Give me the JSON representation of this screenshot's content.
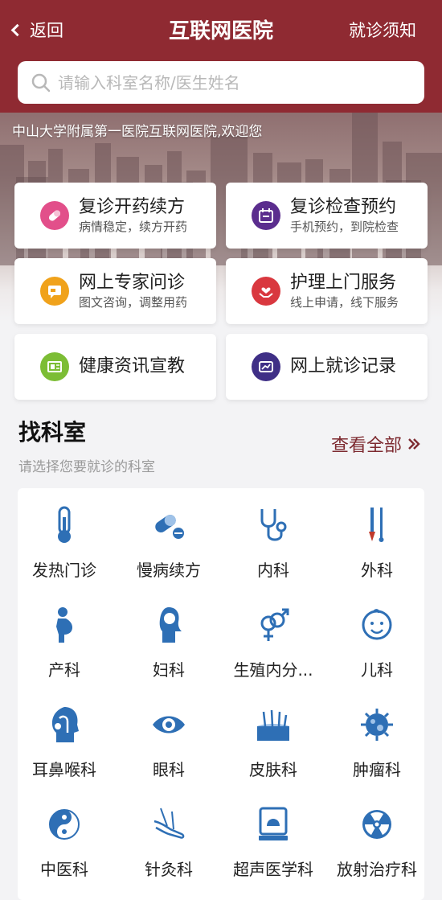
{
  "nav": {
    "back_label": "返回",
    "title": "互联网医院",
    "notice_label": "就诊须知"
  },
  "search": {
    "placeholder": "请输入科室名称/医生姓名",
    "value": ""
  },
  "banner": {
    "welcome": "中山大学附属第一医院互联网医院,欢迎您"
  },
  "services": [
    {
      "name": "复诊开药续方",
      "sub": "病情稳定，续方开药",
      "icon": "pill-icon",
      "color": "#e24f8a"
    },
    {
      "name": "复诊检查预约",
      "sub": "手机预约，到院检查",
      "icon": "calendar-icon",
      "color": "#5b2d8e"
    },
    {
      "name": "网上专家问诊",
      "sub": "图文咨询，调整用药",
      "icon": "chat-icon",
      "color": "#f0a21b"
    },
    {
      "name": "护理上门服务",
      "sub": "线上申请，线下服务",
      "icon": "care-hands-icon",
      "color": "#d9383f"
    },
    {
      "name": "健康资讯宣教",
      "sub": "",
      "icon": "news-icon",
      "color": "#7cbd35"
    },
    {
      "name": "网上就诊记录",
      "sub": "",
      "icon": "record-icon",
      "color": "#3f2f86"
    }
  ],
  "departments_section": {
    "title": "找科室",
    "subtitle": "请选择您要就诊的科室",
    "view_all": "查看全部"
  },
  "departments": [
    {
      "name": "发热门诊",
      "icon": "thermometer-icon"
    },
    {
      "name": "慢病续方",
      "icon": "capsule-icon"
    },
    {
      "name": "内科",
      "icon": "stethoscope-icon"
    },
    {
      "name": "外科",
      "icon": "surgical-tools-icon"
    },
    {
      "name": "产科",
      "icon": "pregnant-icon"
    },
    {
      "name": "妇科",
      "icon": "woman-icon"
    },
    {
      "name": "生殖内分...",
      "icon": "gender-icon"
    },
    {
      "name": "儿科",
      "icon": "baby-face-icon"
    },
    {
      "name": "耳鼻喉科",
      "icon": "ent-head-icon"
    },
    {
      "name": "眼科",
      "icon": "eye-icon"
    },
    {
      "name": "皮肤科",
      "icon": "skin-icon"
    },
    {
      "name": "肿瘤科",
      "icon": "tumor-cell-icon"
    },
    {
      "name": "中医科",
      "icon": "yin-yang-icon"
    },
    {
      "name": "针灸科",
      "icon": "acupuncture-hand-icon"
    },
    {
      "name": "超声医学科",
      "icon": "ultrasound-icon"
    },
    {
      "name": "放射治疗科",
      "icon": "radiation-icon"
    }
  ],
  "colors": {
    "brand": "#8f2a32",
    "dept_icon": "#2e6fb5",
    "view_all": "#7d2a30"
  }
}
